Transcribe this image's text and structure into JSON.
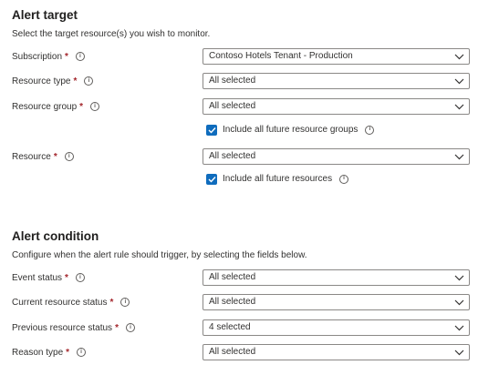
{
  "alert_target": {
    "title": "Alert target",
    "description": "Select the target resource(s) you wish to monitor.",
    "fields": [
      {
        "label": "Subscription",
        "value": "Contoso Hotels Tenant - Production"
      },
      {
        "label": "Resource type",
        "value": "All selected"
      },
      {
        "label": "Resource group",
        "value": "All selected"
      },
      {
        "label": "Resource",
        "value": "All selected"
      }
    ],
    "include_future_resource_groups": {
      "label": "Include all future resource groups",
      "checked": true
    },
    "include_future_resources": {
      "label": "Include all future resources",
      "checked": true
    }
  },
  "alert_condition": {
    "title": "Alert condition",
    "description": "Configure when the alert rule should trigger, by selecting the fields below.",
    "fields": [
      {
        "label": "Event status",
        "value": "All selected"
      },
      {
        "label": "Current resource status",
        "value": "All selected"
      },
      {
        "label": "Previous resource status",
        "value": "4 selected"
      },
      {
        "label": "Reason type",
        "value": "All selected"
      }
    ]
  },
  "required_marker": "*",
  "info_glyph": "i",
  "icons": {
    "dropdown": "chevron-down-icon",
    "info": "info-icon",
    "checkbox": "checkmark-icon"
  },
  "colors": {
    "accent": "#0f6cbd",
    "required": "#a4262c",
    "border": "#8a8886",
    "text": "#323130"
  }
}
